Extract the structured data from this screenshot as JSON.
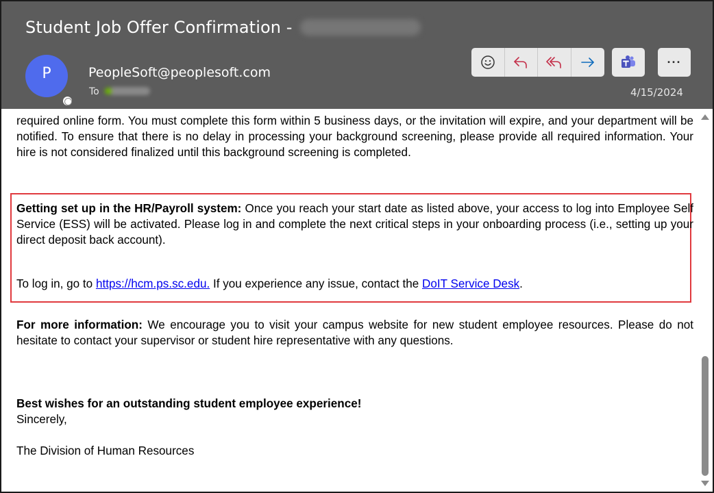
{
  "email": {
    "subject": "Student Job Offer Confirmation - ",
    "sender_initial": "P",
    "sender": "PeopleSoft@peoplesoft.com",
    "to_label": "To",
    "date": "4/15/2024"
  },
  "toolbar": {
    "more_label": "···",
    "icons": [
      "emoji-icon",
      "reply-icon",
      "reply-all-icon",
      "forward-icon",
      "teams-icon",
      "more-icon"
    ]
  },
  "body": {
    "p1": "required online form. You must complete this form within 5 business days, or the invitation will expire, and your department will be notified. To ensure that there is no delay in processing your background screening, please provide all required information. Your hire is not considered finalized until this background screening is completed.",
    "hr_heading": "Getting set up in the HR/Payroll system:",
    "hr_text": " Once you reach your start date as listed above, your access to log into Employee Self Service (ESS) will be activated. Please log in and complete the next critical steps in your onboarding process (i.e., setting up your direct deposit back account).",
    "login_prefix": "To log in, go to ",
    "login_link": "https://hcm.ps.sc.edu.",
    "login_middle": " If you experience any issue, contact the ",
    "desk_link": "DoIT Service Desk",
    "login_suffix": ".",
    "info_heading": "For more information:",
    "info_text": " We encourage you to visit your campus website for new student employee resources. Please do not hesitate to contact your supervisor or student hire representative with any questions.",
    "wishes": "Best wishes for an outstanding student employee experience!",
    "sincerely": "Sincerely,",
    "signature": "The Division of Human Resources"
  },
  "colors": {
    "header_bg": "#5c5c5c",
    "avatar": "#4f6bed",
    "highlight_border": "#e0393e",
    "link": "#0000ee",
    "reply_icon": "#c4314b",
    "forward_icon": "#0f6cbd",
    "teams": "#4b53bc"
  }
}
